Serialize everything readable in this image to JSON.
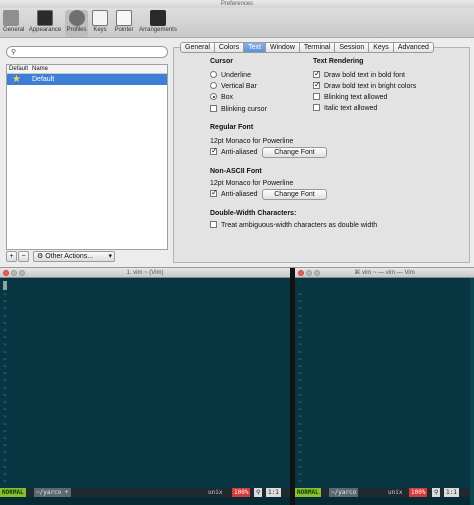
{
  "prefs": {
    "title": "Preferences",
    "toolbar": [
      "General",
      "Appearance",
      "Profiles",
      "Keys",
      "Pointer",
      "Arrangements"
    ],
    "search_icon": "search-icon",
    "columns": {
      "default": "Default",
      "name": "Name"
    },
    "profile": "Default",
    "add": "+",
    "remove": "−",
    "other_actions": "Other Actions...",
    "tabs": [
      "General",
      "Colors",
      "Text",
      "Window",
      "Terminal",
      "Session",
      "Keys",
      "Advanced"
    ],
    "selected_tab": "Text",
    "cursor": {
      "heading": "Cursor",
      "underline": "Underline",
      "vertical_bar": "Vertical Bar",
      "box": "Box",
      "blinking": "Blinking cursor"
    },
    "text_rendering": {
      "heading": "Text Rendering",
      "bold_font": "Draw bold text in bold font",
      "bold_bright": "Draw bold text in bright colors",
      "blinking_text": "Blinking text allowed",
      "italic_text": "Italic text allowed"
    },
    "regular_font": {
      "heading": "Regular Font",
      "font": "12pt Monaco for Powerline",
      "anti_aliased": "Anti-aliased",
      "change": "Change Font"
    },
    "non_ascii_font": {
      "heading": "Non-ASCII Font",
      "font": "12pt Monaco for Powerline",
      "anti_aliased": "Anti-aliased",
      "change": "Change Font"
    },
    "double_width": {
      "heading": "Double-Width Characters:",
      "treat": "Treat ambiguous-width characters as double width"
    }
  },
  "vim_left": {
    "title": "1. vim ~ (Vim)",
    "mode": "NORMAL",
    "branch": "~/yarco +",
    "fileformat": "unix",
    "percent": "100%",
    "pos": "1:1"
  },
  "vim_right": {
    "title": "⌘ vim ~ — vim — Vim",
    "mode": "NORMAL",
    "branch": "~/yarco",
    "fileformat": "unix",
    "percent": "100%",
    "pos": "1:1"
  },
  "colors": {
    "vim_bg": "#073642",
    "selection": "#3d7fd6",
    "mode_green": "#85c12c",
    "percent_red": "#d33a3a"
  }
}
